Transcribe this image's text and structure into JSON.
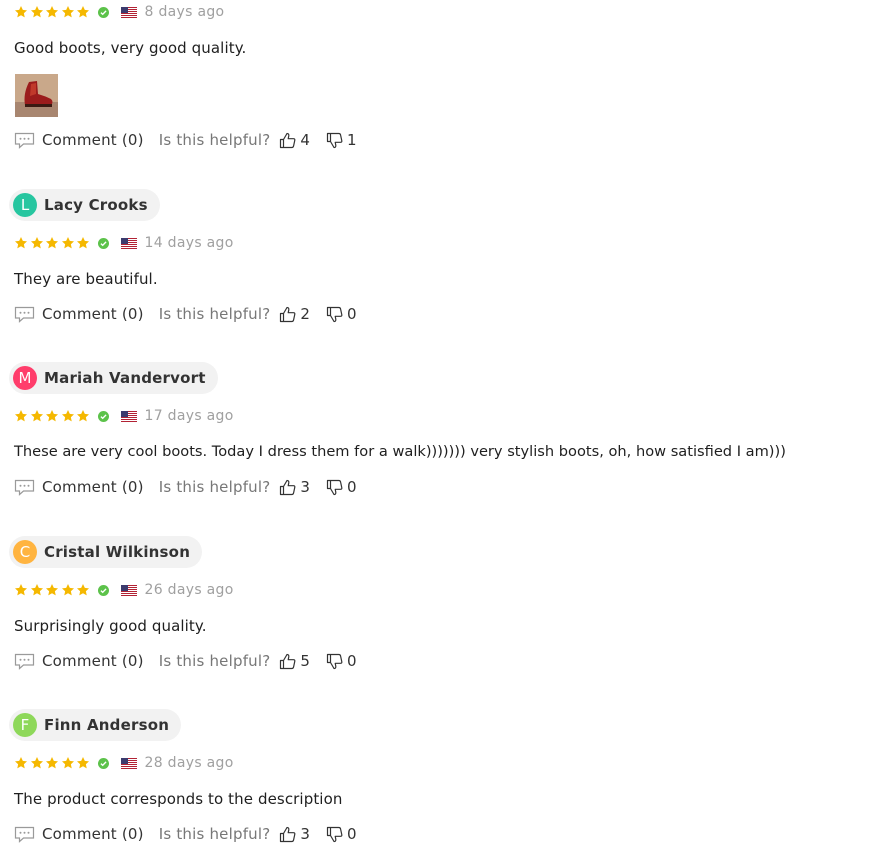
{
  "labels": {
    "comment": "Comment (0)",
    "helpful": "Is this helpful?"
  },
  "colors": {
    "star": "#f5b800",
    "verified": "#5cc24a",
    "avatar_teal": "#27c6a0",
    "avatar_pink": "#ff3d6b",
    "avatar_orange": "#ffb440",
    "avatar_green": "#8ed85a"
  },
  "reviews": [
    {
      "author": null,
      "initial": null,
      "rating": 5,
      "verified": true,
      "country_flag": "us-flag-icon",
      "date": "8 days ago",
      "text": "Good boots, very good quality.",
      "has_photo": true,
      "photo_description": "boot-photo-thumbnail",
      "comment_label": "Comment (0)",
      "helpful_label": "Is this helpful?",
      "likes": "4",
      "dislikes": "1"
    },
    {
      "author": "Lacy Crooks",
      "initial": "L",
      "avatar_color": "#27c6a0",
      "rating": 5,
      "verified": true,
      "country_flag": "us-flag-icon",
      "date": "14 days ago",
      "text": "They are beautiful.",
      "has_photo": false,
      "comment_label": "Comment (0)",
      "helpful_label": "Is this helpful?",
      "likes": "2",
      "dislikes": "0"
    },
    {
      "author": "Mariah Vandervort",
      "initial": "M",
      "avatar_color": "#ff3d6b",
      "rating": 5,
      "verified": true,
      "country_flag": "us-flag-icon",
      "date": "17 days ago",
      "text": "These are very cool boots. Today I dress them for a walk))))))) very stylish boots, oh, how satisfied I am)))",
      "has_photo": false,
      "comment_label": "Comment (0)",
      "helpful_label": "Is this helpful?",
      "likes": "3",
      "dislikes": "0"
    },
    {
      "author": "Cristal Wilkinson",
      "initial": "C",
      "avatar_color": "#ffb440",
      "rating": 5,
      "verified": true,
      "country_flag": "us-flag-icon",
      "date": "26 days ago",
      "text": "Surprisingly good quality.",
      "has_photo": false,
      "comment_label": "Comment (0)",
      "helpful_label": "Is this helpful?",
      "likes": "5",
      "dislikes": "0"
    },
    {
      "author": "Finn Anderson",
      "initial": "F",
      "avatar_color": "#8ed85a",
      "rating": 5,
      "verified": true,
      "country_flag": "us-flag-icon",
      "date": "28 days ago",
      "text": "The product corresponds to the description",
      "has_photo": false,
      "comment_label": "Comment (0)",
      "helpful_label": "Is this helpful?",
      "likes": "3",
      "dislikes": "0"
    }
  ]
}
